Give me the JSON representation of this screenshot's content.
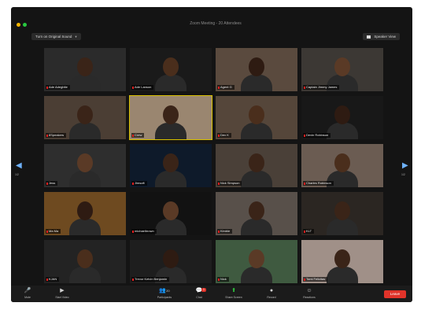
{
  "window": {
    "title": "Zoom Meeting - 20 Attendees"
  },
  "top_controls": {
    "original_sound_label": "Turn on Original Sound",
    "speaker_view_label": "Speaker View"
  },
  "pagination": {
    "left_page": "1/2",
    "right_page": "1/2"
  },
  "participants": [
    {
      "name": "Ade Adegbite",
      "active": false
    },
    {
      "name": "Ade Lanson",
      "active": false
    },
    {
      "name": "Agent G",
      "active": false
    },
    {
      "name": "Captain Jimmy James",
      "active": false
    },
    {
      "name": "8Speakers",
      "active": false
    },
    {
      "name": "Crew",
      "active": true
    },
    {
      "name": "Dex K",
      "active": false
    },
    {
      "name": "Devin Robinson",
      "active": false
    },
    {
      "name": "Jess",
      "active": false
    },
    {
      "name": "Jimsoft",
      "active": false
    },
    {
      "name": "Nick Simpson",
      "active": false
    },
    {
      "name": "Charles Robinson",
      "active": false
    },
    {
      "name": "Ma Ma",
      "active": false
    },
    {
      "name": "michaelbrown",
      "active": false
    },
    {
      "name": "Kimble",
      "active": false
    },
    {
      "name": "KLT",
      "active": false
    },
    {
      "name": "KJAN",
      "active": false
    },
    {
      "name": "Trevor Kelvin Benjamin",
      "active": false
    },
    {
      "name": "Nick",
      "active": false
    },
    {
      "name": "Tomi Felicitas",
      "active": false
    }
  ],
  "toolbar": {
    "mute": "Mute",
    "video": "Start Video",
    "participants": "Participants",
    "participants_count": "20",
    "chat": "Chat",
    "share": "Share Screen",
    "record": "Record",
    "reactions": "Reactions",
    "end": "Leave"
  },
  "colors": {
    "accent_green": "#2ecc40",
    "end_red": "#e0332a",
    "active_speaker": "#d8c000",
    "arrow_blue": "#6fb3ff"
  }
}
